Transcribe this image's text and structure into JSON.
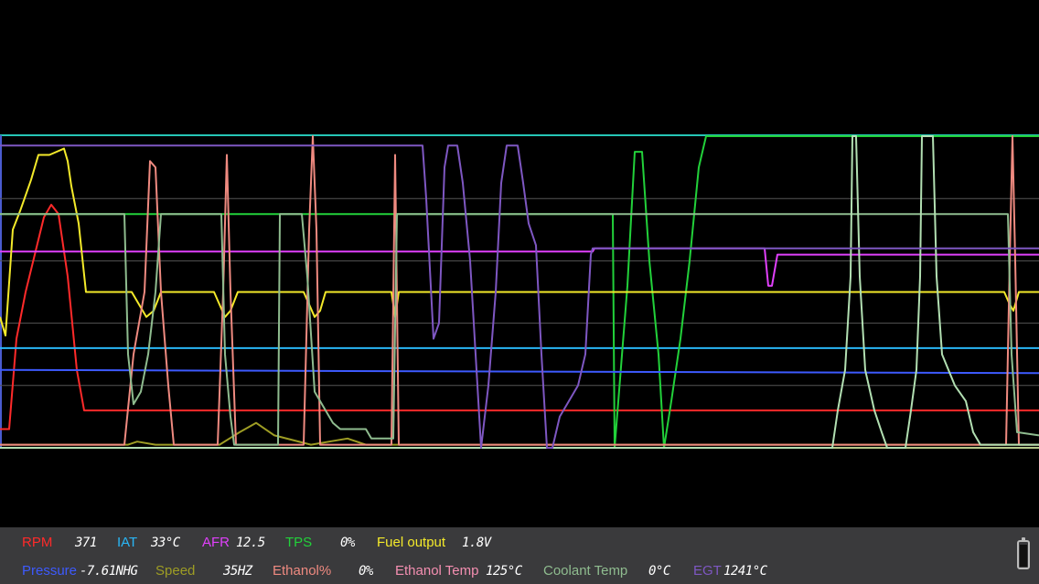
{
  "gauges_row1": [
    {
      "id": "rpm",
      "label": "RPM",
      "value": "371",
      "color": "#ff2a2a"
    },
    {
      "id": "iat",
      "label": "IAT",
      "value": "33°C",
      "color": "#29b6f6"
    },
    {
      "id": "afr",
      "label": "AFR",
      "value": "12.5",
      "color": "#e040fb"
    },
    {
      "id": "tps",
      "label": "TPS",
      "value": "0%",
      "color": "#22d13a"
    },
    {
      "id": "fuel_output",
      "label": "Fuel output",
      "value": "1.8V",
      "color": "#f4ea2a"
    }
  ],
  "gauges_row2": [
    {
      "id": "pressure",
      "label": "Pressure",
      "value": "-7.61NHG",
      "color": "#3d5afe"
    },
    {
      "id": "speed",
      "label": "Speed",
      "value": "35HZ",
      "color": "#9e9d24"
    },
    {
      "id": "ethanol_pct",
      "label": "Ethanol%",
      "value": "0%",
      "color": "#ef8a80"
    },
    {
      "id": "ethanol_temp",
      "label": "Ethanol Temp",
      "value": "125°C",
      "color": "#f48fb1"
    },
    {
      "id": "coolant_temp",
      "label": "Coolant Temp",
      "value": "0°C",
      "color": "#8fbc8f"
    },
    {
      "id": "egt",
      "label": "EGT",
      "value": "1241°C",
      "color": "#7e57c2"
    }
  ],
  "chart_data": {
    "type": "line",
    "title": "",
    "xlabel": "",
    "ylabel": "",
    "grid": true,
    "legend": "bottom",
    "colors": {
      "frame": "#26c6b6",
      "grid": "#555555",
      "baseline": "#b5c98a"
    },
    "series": [
      {
        "name": "RPM",
        "color": "#ff2a2a",
        "points": [
          [
            0,
            0.06
          ],
          [
            10,
            0.06
          ],
          [
            18,
            0.35
          ],
          [
            28,
            0.5
          ],
          [
            48,
            0.74
          ],
          [
            56,
            0.78
          ],
          [
            64,
            0.75
          ],
          [
            74,
            0.55
          ],
          [
            84,
            0.25
          ],
          [
            92,
            0.12
          ],
          [
            1136,
            0.12
          ]
        ]
      },
      {
        "name": "IAT",
        "color": "#29b6f6",
        "points": [
          [
            0,
            0.32
          ],
          [
            1136,
            0.32
          ]
        ]
      },
      {
        "name": "AFR",
        "color": "#e040fb",
        "points": [
          [
            0,
            0.63
          ],
          [
            648,
            0.63
          ],
          [
            650,
            0.64
          ],
          [
            836,
            0.64
          ],
          [
            840,
            0.52
          ],
          [
            844,
            0.52
          ],
          [
            850,
            0.62
          ],
          [
            1136,
            0.62
          ]
        ]
      },
      {
        "name": "TPS",
        "color": "#22d13a",
        "points": [
          [
            0,
            0.75
          ],
          [
            670,
            0.75
          ],
          [
            672,
            0
          ],
          [
            686,
            0.52
          ],
          [
            694,
            0.95
          ],
          [
            702,
            0.95
          ],
          [
            710,
            0.6
          ],
          [
            720,
            0.3
          ],
          [
            726,
            0
          ],
          [
            734,
            0.15
          ],
          [
            744,
            0.35
          ],
          [
            754,
            0.6
          ],
          [
            764,
            0.9
          ],
          [
            772,
            1.0
          ],
          [
            1136,
            1.0
          ]
        ]
      },
      {
        "name": "Fuel output",
        "color": "#f4ea2a",
        "points": [
          [
            0,
            0.42
          ],
          [
            6,
            0.36
          ],
          [
            14,
            0.7
          ],
          [
            22,
            0.76
          ],
          [
            34,
            0.86
          ],
          [
            42,
            0.94
          ],
          [
            54,
            0.94
          ],
          [
            70,
            0.96
          ],
          [
            74,
            0.92
          ],
          [
            78,
            0.84
          ],
          [
            86,
            0.72
          ],
          [
            94,
            0.5
          ],
          [
            144,
            0.5
          ],
          [
            152,
            0.46
          ],
          [
            160,
            0.42
          ],
          [
            168,
            0.44
          ],
          [
            176,
            0.5
          ],
          [
            234,
            0.5
          ],
          [
            240,
            0.46
          ],
          [
            246,
            0.42
          ],
          [
            252,
            0.44
          ],
          [
            260,
            0.5
          ],
          [
            332,
            0.5
          ],
          [
            338,
            0.46
          ],
          [
            344,
            0.42
          ],
          [
            350,
            0.44
          ],
          [
            356,
            0.5
          ],
          [
            428,
            0.5
          ],
          [
            432,
            0.42
          ],
          [
            436,
            0.5
          ],
          [
            1098,
            0.5
          ],
          [
            1104,
            0.46
          ],
          [
            1108,
            0.44
          ],
          [
            1114,
            0.5
          ],
          [
            1136,
            0.5
          ]
        ]
      },
      {
        "name": "Pressure",
        "color": "#3d5afe",
        "points": [
          [
            0,
            0.25
          ],
          [
            1136,
            0.24
          ]
        ]
      },
      {
        "name": "Speed",
        "color": "#9e9d24",
        "points": [
          [
            0,
            0.01
          ],
          [
            140,
            0.01
          ],
          [
            150,
            0.02
          ],
          [
            170,
            0.01
          ],
          [
            240,
            0.01
          ],
          [
            262,
            0.05
          ],
          [
            280,
            0.08
          ],
          [
            300,
            0.04
          ],
          [
            340,
            0.01
          ],
          [
            360,
            0.02
          ],
          [
            380,
            0.03
          ],
          [
            400,
            0.01
          ],
          [
            1136,
            0.01
          ]
        ]
      },
      {
        "name": "Ethanol%",
        "color": "#ef8a80",
        "points": [
          [
            0,
            0.01
          ],
          [
            136,
            0.01
          ],
          [
            146,
            0.3
          ],
          [
            158,
            0.5
          ],
          [
            164,
            0.92
          ],
          [
            170,
            0.9
          ],
          [
            176,
            0.5
          ],
          [
            184,
            0.2
          ],
          [
            190,
            0.01
          ],
          [
            238,
            0.01
          ],
          [
            244,
            0.5
          ],
          [
            248,
            0.94
          ],
          [
            252,
            0.5
          ],
          [
            258,
            0.01
          ],
          [
            332,
            0.01
          ],
          [
            338,
            0.7
          ],
          [
            342,
            1.0
          ],
          [
            346,
            0.7
          ],
          [
            350,
            0.01
          ],
          [
            428,
            0.01
          ],
          [
            432,
            0.94
          ],
          [
            436,
            0.01
          ],
          [
            1100,
            0.01
          ],
          [
            1104,
            0.6
          ],
          [
            1107,
            1.0
          ],
          [
            1110,
            0.6
          ],
          [
            1114,
            0.01
          ],
          [
            1136,
            0.01
          ]
        ]
      },
      {
        "name": "Coolant Temp",
        "color": "#8fbc8f",
        "points": [
          [
            0,
            0.75
          ],
          [
            136,
            0.75
          ],
          [
            140,
            0.3
          ],
          [
            146,
            0.14
          ],
          [
            154,
            0.18
          ],
          [
            162,
            0.3
          ],
          [
            170,
            0.5
          ],
          [
            176,
            0.75
          ],
          [
            242,
            0.75
          ],
          [
            246,
            0.3
          ],
          [
            252,
            0.1
          ],
          [
            256,
            0.01
          ],
          [
            304,
            0.01
          ],
          [
            306,
            0.75
          ],
          [
            330,
            0.75
          ],
          [
            336,
            0.55
          ],
          [
            344,
            0.18
          ],
          [
            356,
            0.12
          ],
          [
            364,
            0.08
          ],
          [
            372,
            0.06
          ],
          [
            400,
            0.06
          ],
          [
            406,
            0.03
          ],
          [
            430,
            0.03
          ],
          [
            434,
            0.75
          ],
          [
            1102,
            0.75
          ],
          [
            1106,
            0.3
          ],
          [
            1112,
            0.05
          ],
          [
            1136,
            0.04
          ]
        ]
      },
      {
        "name": "Ethanol Temp",
        "color": "#b2dfb2",
        "points": [
          [
            0,
            0.0
          ],
          [
            910,
            0.0
          ],
          [
            916,
            0.12
          ],
          [
            924,
            0.25
          ],
          [
            930,
            0.55
          ],
          [
            932,
            1.0
          ],
          [
            936,
            1.0
          ],
          [
            940,
            0.55
          ],
          [
            946,
            0.25
          ],
          [
            956,
            0.12
          ],
          [
            964,
            0.05
          ],
          [
            970,
            0.0
          ],
          [
            990,
            0.0
          ],
          [
            996,
            0.12
          ],
          [
            1002,
            0.25
          ],
          [
            1006,
            0.55
          ],
          [
            1008,
            1.0
          ],
          [
            1020,
            1.0
          ],
          [
            1024,
            0.55
          ],
          [
            1030,
            0.3
          ],
          [
            1044,
            0.2
          ],
          [
            1056,
            0.15
          ],
          [
            1064,
            0.05
          ],
          [
            1072,
            0.01
          ],
          [
            1136,
            0.01
          ]
        ]
      },
      {
        "name": "EGT",
        "color": "#7e57c2",
        "points": [
          [
            0,
            0.97
          ],
          [
            462,
            0.97
          ],
          [
            466,
            0.8
          ],
          [
            474,
            0.35
          ],
          [
            480,
            0.4
          ],
          [
            486,
            0.9
          ],
          [
            490,
            0.97
          ],
          [
            500,
            0.97
          ],
          [
            506,
            0.85
          ],
          [
            514,
            0.6
          ],
          [
            520,
            0.3
          ],
          [
            526,
            0.0
          ],
          [
            534,
            0.2
          ],
          [
            542,
            0.5
          ],
          [
            548,
            0.85
          ],
          [
            554,
            0.97
          ],
          [
            566,
            0.97
          ],
          [
            572,
            0.85
          ],
          [
            578,
            0.72
          ],
          [
            586,
            0.65
          ],
          [
            592,
            0.3
          ],
          [
            598,
            0.0
          ],
          [
            604,
            0.0
          ],
          [
            612,
            0.1
          ],
          [
            622,
            0.15
          ],
          [
            632,
            0.2
          ],
          [
            640,
            0.3
          ],
          [
            646,
            0.62
          ],
          [
            648,
            0.64
          ],
          [
            1136,
            0.64
          ]
        ]
      }
    ]
  }
}
